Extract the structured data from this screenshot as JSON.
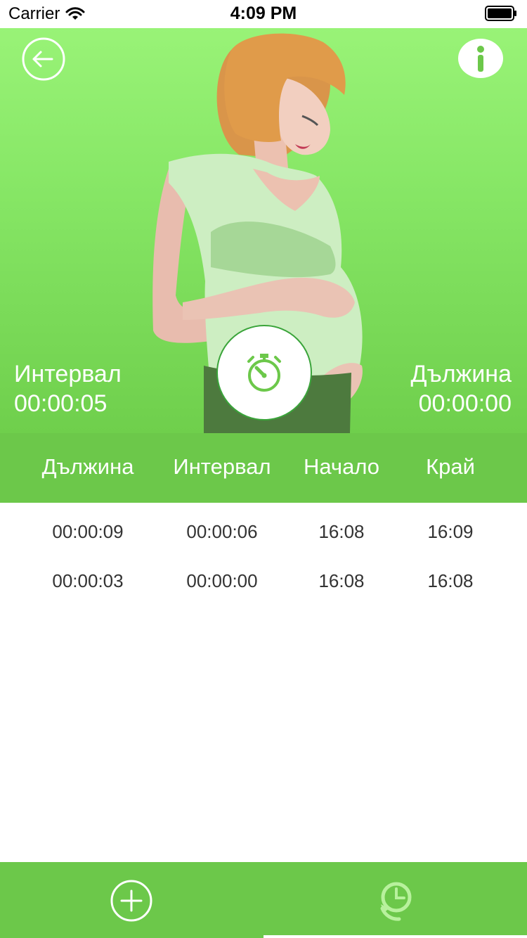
{
  "status_bar": {
    "carrier": "Carrier",
    "time": "4:09 PM"
  },
  "hero": {
    "interval_label": "Интервал",
    "interval_value": "00:00:05",
    "duration_label": "Дължина",
    "duration_value": "00:00:00"
  },
  "table": {
    "headers": [
      "Дължина",
      "Интервал",
      "Начало",
      "Край"
    ],
    "rows": [
      [
        "00:00:09",
        "00:00:06",
        "16:08",
        "16:09"
      ],
      [
        "00:00:03",
        "00:00:00",
        "16:08",
        "16:08"
      ]
    ]
  },
  "colors": {
    "accent": "#6cc84a",
    "hero_top": "#9cf57a",
    "text_dark": "#333333"
  },
  "icons": {
    "back": "arrow-left-circle-icon",
    "info": "info-icon",
    "stopwatch": "stopwatch-icon",
    "add": "plus-circle-icon",
    "history": "clock-history-icon"
  }
}
